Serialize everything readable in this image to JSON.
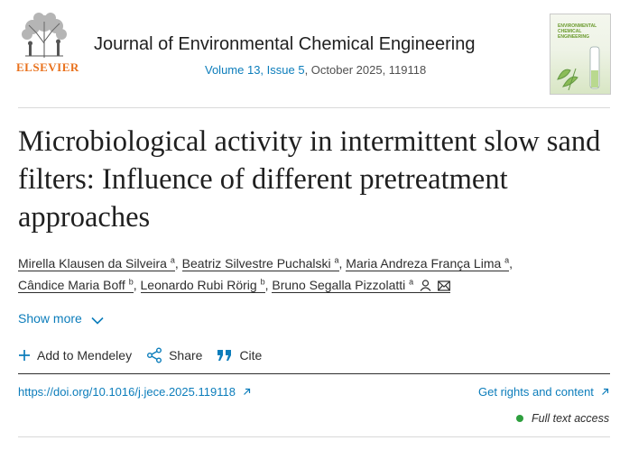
{
  "header": {
    "publisher": "ELSEVIER",
    "journal_title": "Journal of Environmental Chemical Engineering",
    "volume_issue": "Volume 13, Issue 5",
    "date_article": ", October 2025, 119118",
    "cover_text": "ENVIRONMENTAL CHEMICAL ENGINEERING"
  },
  "article": {
    "title": "Microbiological activity in intermittent slow sand filters: Influence of different pretreatment approaches",
    "authors": [
      {
        "name": "Mirella Klausen da Silveira",
        "aff": "a"
      },
      {
        "name": "Beatriz Silvestre Puchalski",
        "aff": "a"
      },
      {
        "name": "Maria Andreza França Lima",
        "aff": "a"
      },
      {
        "name": "Cândice Maria Boff",
        "aff": "b"
      },
      {
        "name": "Leonardo Rubi Rörig",
        "aff": "b"
      },
      {
        "name": "Bruno Segalla Pizzolatti",
        "aff": "a"
      }
    ],
    "separator": ","
  },
  "controls": {
    "show_more": "Show more",
    "add_mendeley": "Add to Mendeley",
    "share": "Share",
    "cite": "Cite",
    "doi": "https://doi.org/10.1016/j.jece.2025.119118",
    "rights": "Get rights and content",
    "access": "Full text access"
  },
  "colors": {
    "link": "#0c7dbb",
    "publisher": "#e9711c",
    "access_dot": "#2e9f3e"
  }
}
